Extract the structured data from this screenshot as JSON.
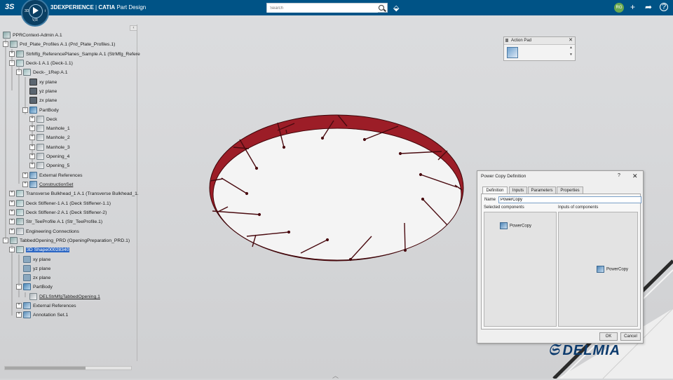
{
  "header": {
    "brand": "3DEXPERIENCE",
    "separator": "|",
    "app": "CATIA",
    "module": "Part Design",
    "search_placeholder": "Search",
    "avatar_initials": "RG",
    "compass_label": "V,R",
    "compass_3d": "3D",
    "compass_i": "i"
  },
  "tree": {
    "collapse_glyph": "‹",
    "nodes": [
      {
        "label": "PPRContext-Admin A.1"
      },
      {
        "label": "Prd_Plate_Profiles A.1 (Prd_Plate_Profiles.1)"
      },
      {
        "label": "StrMfg_ReferencePlanes_Sample A.1 (StrMfg_Refere"
      },
      {
        "label": "Deck-1 A.1 (Deck-1.1)"
      },
      {
        "label": "Deck-_1Rep A.1"
      },
      {
        "label": "xy plane"
      },
      {
        "label": "yz plane"
      },
      {
        "label": "zx plane"
      },
      {
        "label": "PartBody"
      },
      {
        "label": "Deck"
      },
      {
        "label": "Manhole_1"
      },
      {
        "label": "Manhole_2"
      },
      {
        "label": "Manhole_3"
      },
      {
        "label": "Opening_4"
      },
      {
        "label": "Opening_5"
      },
      {
        "label": "External References"
      },
      {
        "label": "ConstructionSet"
      },
      {
        "label": "Transverse Bulkhead_1 A.1 (Transverse Bulkhead_1."
      },
      {
        "label": "Deck Stiffener-1 A.1 (Deck Stiffener-1.1)"
      },
      {
        "label": "Deck Stiffener-2 A.1 (Deck Stiffener-2)"
      },
      {
        "label": "Str_TeeProfile A.1 (Str_TeeProfile.1)"
      },
      {
        "label": "Engineering Connections"
      },
      {
        "label": "TabbedOpening_PRD (OpeningPreparation_PRD.1)"
      },
      {
        "label": "3D Shape00028340"
      },
      {
        "label": "xy plane"
      },
      {
        "label": "yz plane"
      },
      {
        "label": "zx plane"
      },
      {
        "label": "PartBody"
      },
      {
        "label": "DELStrMfgTabbedOpening.1"
      },
      {
        "label": "External References"
      },
      {
        "label": "Annotation Set.1"
      }
    ]
  },
  "action_pad": {
    "title": "Action Pad",
    "close": "✕"
  },
  "dialog": {
    "title": "Power Copy Definition",
    "help": "?",
    "close": "✕",
    "tabs": [
      "Definition",
      "Inputs",
      "Parameters",
      "Properties"
    ],
    "active_tab": "Definition",
    "name_label": "Name",
    "name_value": "PowerCopy",
    "selected_components_label": "Selected components",
    "inputs_of_components_label": "Inputs of components",
    "selected_item": "PowerCopy",
    "input_item": "PowerCopy",
    "ok": "OK",
    "cancel": "Cancel"
  },
  "watermark": {
    "brand": "DELMIA"
  },
  "colors": {
    "topbar": "#005386",
    "opening_rim": "#a3202a",
    "background": "#d4d5d7"
  }
}
